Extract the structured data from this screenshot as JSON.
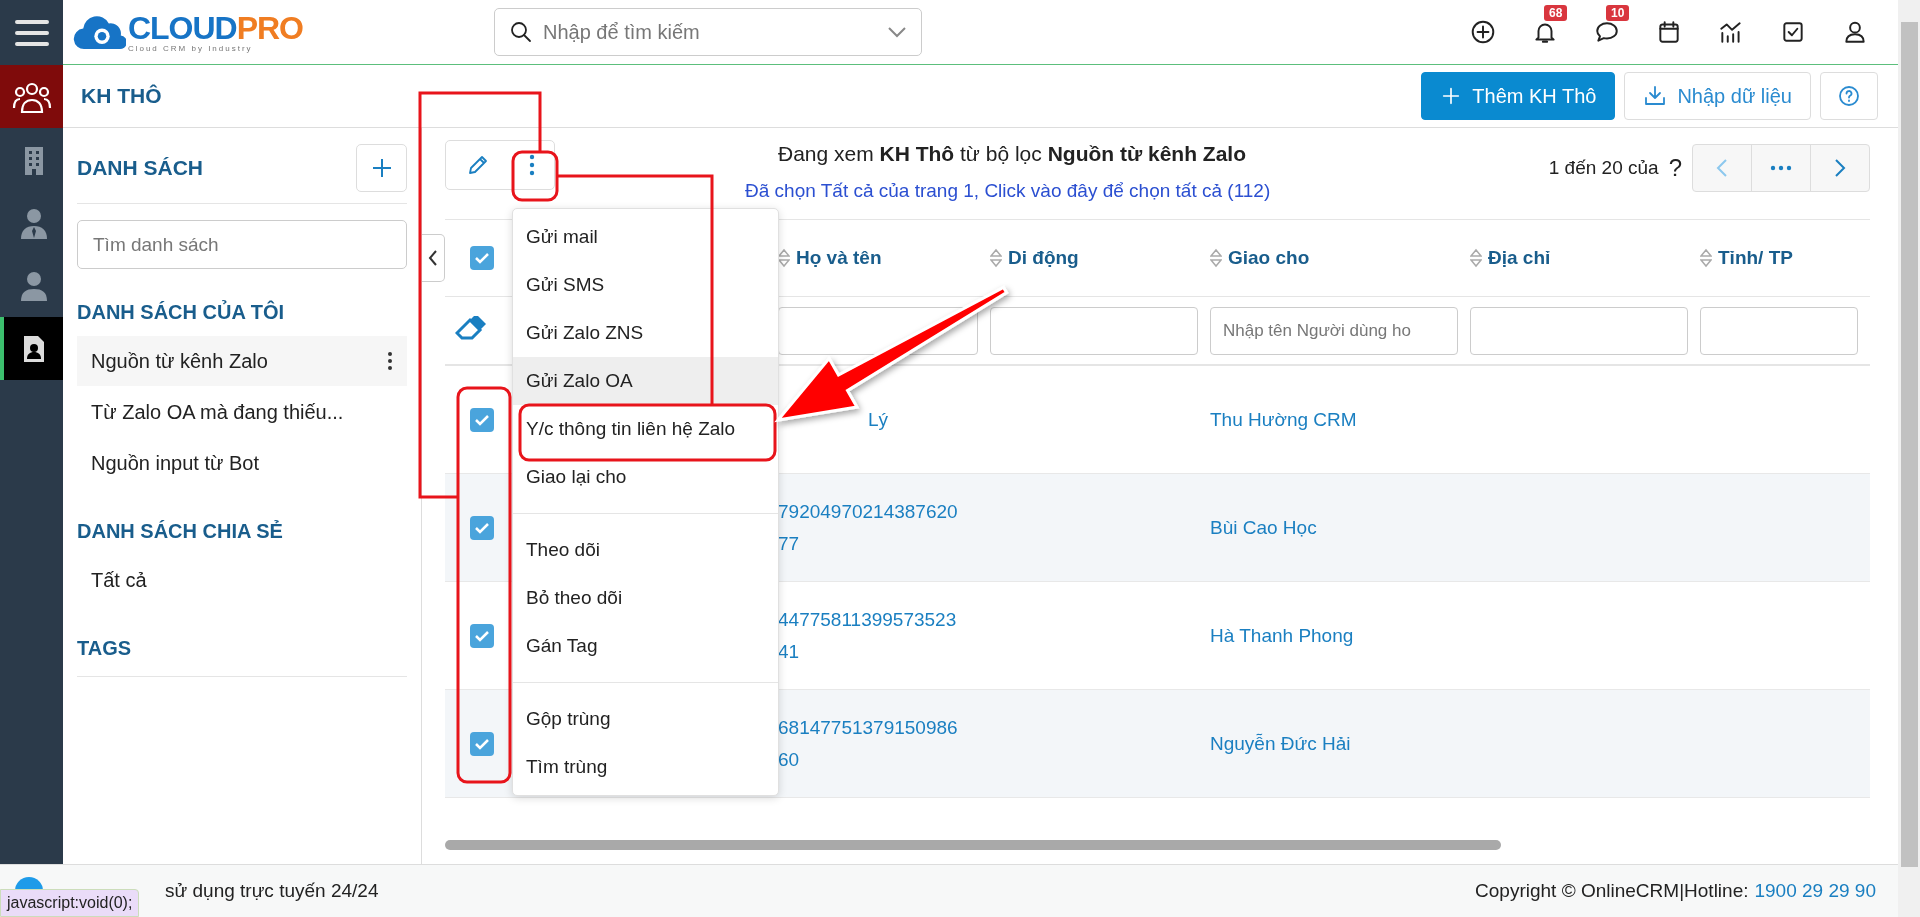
{
  "logo": {
    "part1": "CLOUD",
    "part2": "PRO",
    "tagline": "Cloud CRM by Industry"
  },
  "topbar": {
    "search_placeholder": "Nhập để tìm kiếm",
    "notifications_badge": "68",
    "messages_badge": "10"
  },
  "rail": {
    "items": [
      {
        "selected": false
      },
      {
        "selected": false
      },
      {
        "selected": false
      },
      {
        "selected": true
      }
    ]
  },
  "page": {
    "title": "KH THÔ",
    "buttons": [
      {
        "kind": "primary",
        "label": "Thêm KH Thô"
      },
      {
        "kind": "import",
        "label": "Nhập dữ liệu"
      },
      {
        "kind": "help"
      }
    ]
  },
  "lists": {
    "title": "DANH SÁCH",
    "search_placeholder": "Tìm danh sách",
    "sections": [
      {
        "title": "DANH SÁCH CỦA TÔI",
        "items": [
          {
            "label": "Nguồn từ kênh Zalo",
            "selected": true
          },
          {
            "label": "Từ Zalo OA mà đang thiếu...",
            "selected": false
          },
          {
            "label": "Nguồn input từ Bot",
            "selected": false
          }
        ]
      },
      {
        "title": "DANH SÁCH CHIA SẺ",
        "items": [
          {
            "label": "Tất cả",
            "selected": false
          }
        ]
      },
      {
        "title": "TAGS"
      }
    ]
  },
  "main": {
    "summary": "Đang xem **KH Thô** từ bộ lọc **Nguồn từ kênh Zalo**",
    "select_all_link": "Đã chọn Tất cả của trang 1, Click vào đây để chọn tất cả (112)",
    "pagination": {
      "range": "1 đến 20 của",
      "total": "?"
    }
  },
  "table": {
    "all_checked": true,
    "columns": [
      {
        "label": "Họ và tên"
      },
      {
        "label": "Di động"
      },
      {
        "label": "Giao cho",
        "filter_placeholder": "Nhập tên Người dùng ho"
      },
      {
        "label": "Địa chỉ"
      },
      {
        "label": "Tỉnh/ TP"
      }
    ],
    "rows": [
      {
        "checked": true,
        "name_lines": [
          "Lý"
        ],
        "assigned_to": "Thu Hường CRM"
      },
      {
        "checked": true,
        "name_lines": [
          "79204970214387620",
          "77"
        ],
        "assigned_to": "Bùi Cao Học"
      },
      {
        "checked": true,
        "name_lines": [
          "44775811399573523",
          "41"
        ],
        "assigned_to": "Hà Thanh Phong"
      },
      {
        "checked": true,
        "name_lines": [
          "68147751379150986",
          "60"
        ],
        "assigned_to": "Nguyễn Đức Hải"
      }
    ]
  },
  "menu": {
    "groups": [
      [
        {
          "label": "Gửi mail",
          "highlighted": false
        },
        {
          "label": "Gửi SMS",
          "highlighted": false
        },
        {
          "label": "Gửi Zalo ZNS",
          "highlighted": false
        },
        {
          "label": "Gửi Zalo OA",
          "highlighted": true
        },
        {
          "label": "Y/c thông tin liên hệ Zalo",
          "highlighted": false
        },
        {
          "label": "Giao lại cho",
          "highlighted": false
        }
      ],
      [
        {
          "label": "Theo dõi",
          "highlighted": false
        },
        {
          "label": "Bỏ theo dõi",
          "highlighted": false
        },
        {
          "label": "Gán Tag",
          "highlighted": false
        }
      ],
      [
        {
          "label": "Gộp trùng",
          "highlighted": false
        },
        {
          "label": "Tìm trùng",
          "highlighted": false
        }
      ]
    ]
  },
  "status": {
    "text": "sử dụng trực tuyến 24/24",
    "tooltip": "javascript:void(0);",
    "copyright": "Copyright © OnlineCRM|Hotline:",
    "hotline": "1900 29 29 90"
  }
}
